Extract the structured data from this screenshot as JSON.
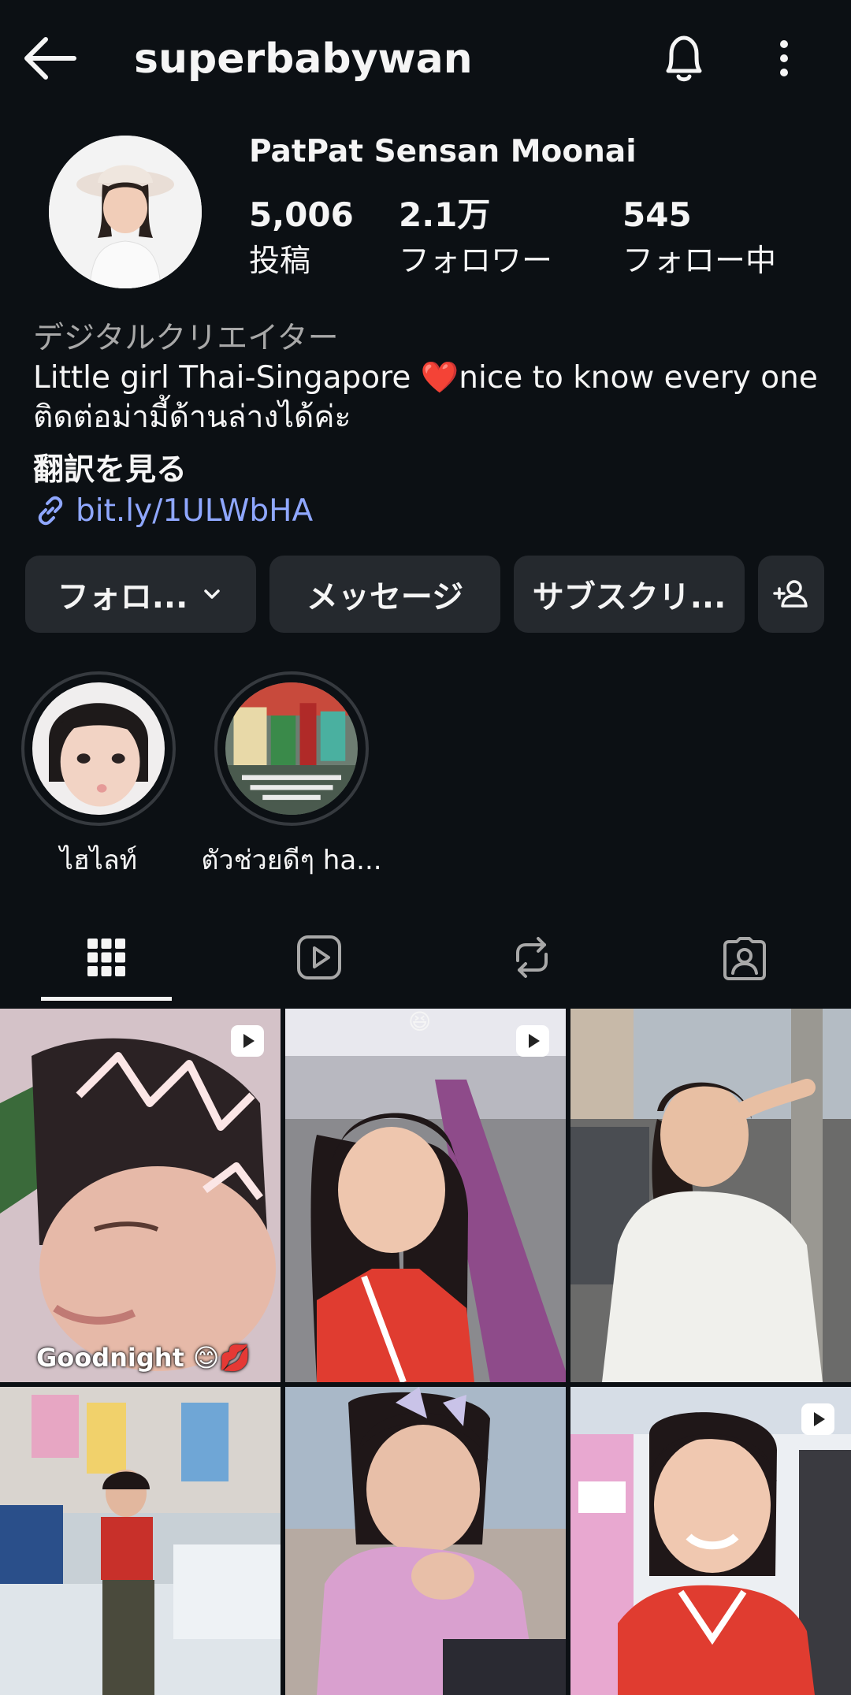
{
  "header": {
    "username": "superbabywan",
    "icons": {
      "back": "back-arrow-icon",
      "bell": "bell-icon",
      "more": "more-vertical-icon"
    }
  },
  "profile": {
    "display_name": "PatPat Sensan Moonai",
    "stats": {
      "posts": {
        "value": "5,006",
        "label": "投稿"
      },
      "followers": {
        "value": "2.1万",
        "label": "フォロワー"
      },
      "following": {
        "value": "545",
        "label": "フォロー中"
      }
    },
    "category": "デジタルクリエイター",
    "bio": "Little girl Thai-Singapore ❤️nice to know every one ติดต่อม่ามี้ด้านล่างได้ค่ะ",
    "translate_label": "翻訳を見る",
    "link": "bit.ly/1ULWbHA"
  },
  "actions": {
    "follow_label": "フォロ...",
    "message_label": "メッセージ",
    "subscribe_label": "サブスクリ..."
  },
  "highlights": [
    {
      "label": "ไฮไลท์"
    },
    {
      "label": "ตัวช่วยดีๆ ha..."
    }
  ],
  "tabs": [
    "posts-grid",
    "reels",
    "reposts",
    "tagged"
  ],
  "grid": {
    "posts": [
      {
        "type": "reel",
        "caption": "Goodnight 😊💋"
      },
      {
        "type": "reel",
        "top_emoji": "😆"
      },
      {
        "type": "photo"
      },
      {
        "type": "photo"
      },
      {
        "type": "photo"
      },
      {
        "type": "reel"
      }
    ]
  },
  "colors": {
    "background": "#0c1014",
    "button": "#25292e",
    "link": "#8fa7ff",
    "secondary_text": "#a8a8a8"
  }
}
